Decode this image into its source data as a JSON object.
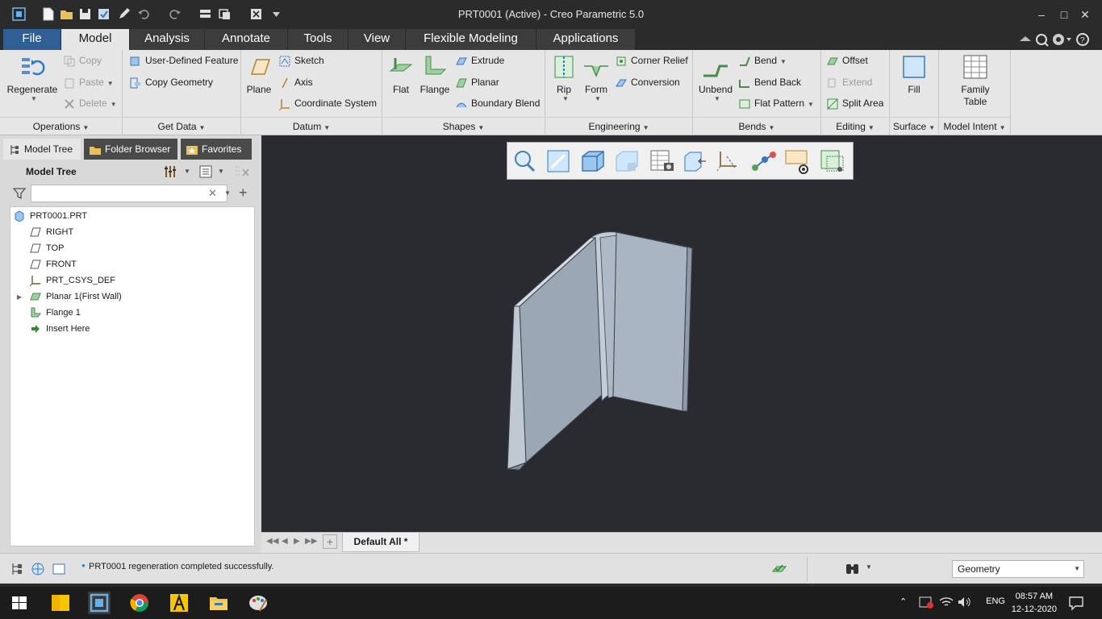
{
  "window": {
    "title": "PRT0001 (Active) - Creo Parametric 5.0"
  },
  "tabs": [
    {
      "label": "File"
    },
    {
      "label": "Model"
    },
    {
      "label": "Analysis"
    },
    {
      "label": "Annotate"
    },
    {
      "label": "Tools"
    },
    {
      "label": "View"
    },
    {
      "label": "Flexible Modeling"
    },
    {
      "label": "Applications"
    }
  ],
  "ribbon": {
    "operations": {
      "name": "Operations",
      "regenerate": "Regenerate",
      "copy": "Copy",
      "paste": "Paste",
      "delete": "Delete"
    },
    "get_data": {
      "name": "Get Data",
      "udf": "User-Defined Feature",
      "copy_geometry": "Copy Geometry"
    },
    "datum": {
      "name": "Datum",
      "plane": "Plane",
      "sketch": "Sketch",
      "axis": "Axis",
      "csys": "Coordinate System"
    },
    "shapes": {
      "name": "Shapes",
      "flat": "Flat",
      "flange": "Flange",
      "extrude": "Extrude",
      "planar": "Planar",
      "boundary_blend": "Boundary Blend"
    },
    "engineering": {
      "name": "Engineering",
      "rip": "Rip",
      "form": "Form",
      "corner_relief": "Corner Relief",
      "conversion": "Conversion"
    },
    "bends": {
      "name": "Bends",
      "unbend": "Unbend",
      "bend": "Bend",
      "bend_back": "Bend Back",
      "flat_pattern": "Flat Pattern"
    },
    "editing": {
      "name": "Editing",
      "offset": "Offset",
      "extend": "Extend",
      "split_area": "Split Area"
    },
    "surface": {
      "name": "Surface",
      "fill": "Fill"
    },
    "model_intent": {
      "name": "Model Intent",
      "family_table_1": "Family",
      "family_table_2": "Table"
    }
  },
  "navigator": {
    "tabs": [
      {
        "label": "Model Tree"
      },
      {
        "label": "Folder Browser"
      },
      {
        "label": "Favorites"
      }
    ],
    "header": "Model Tree",
    "search_value": "",
    "items": [
      {
        "label": "PRT0001.PRT"
      },
      {
        "label": "RIGHT"
      },
      {
        "label": "TOP"
      },
      {
        "label": "FRONT"
      },
      {
        "label": "PRT_CSYS_DEF"
      },
      {
        "label": "Planar 1(First Wall)"
      },
      {
        "label": "Flange 1"
      },
      {
        "label": "Insert Here"
      }
    ]
  },
  "sheet_tab": "Default All *",
  "status": {
    "message": "PRT0001 regeneration completed successfully.",
    "selection_filter": "Geometry"
  },
  "taskbar": {
    "language": "ENG",
    "time": "08:57 AM",
    "date": "12-12-2020"
  }
}
